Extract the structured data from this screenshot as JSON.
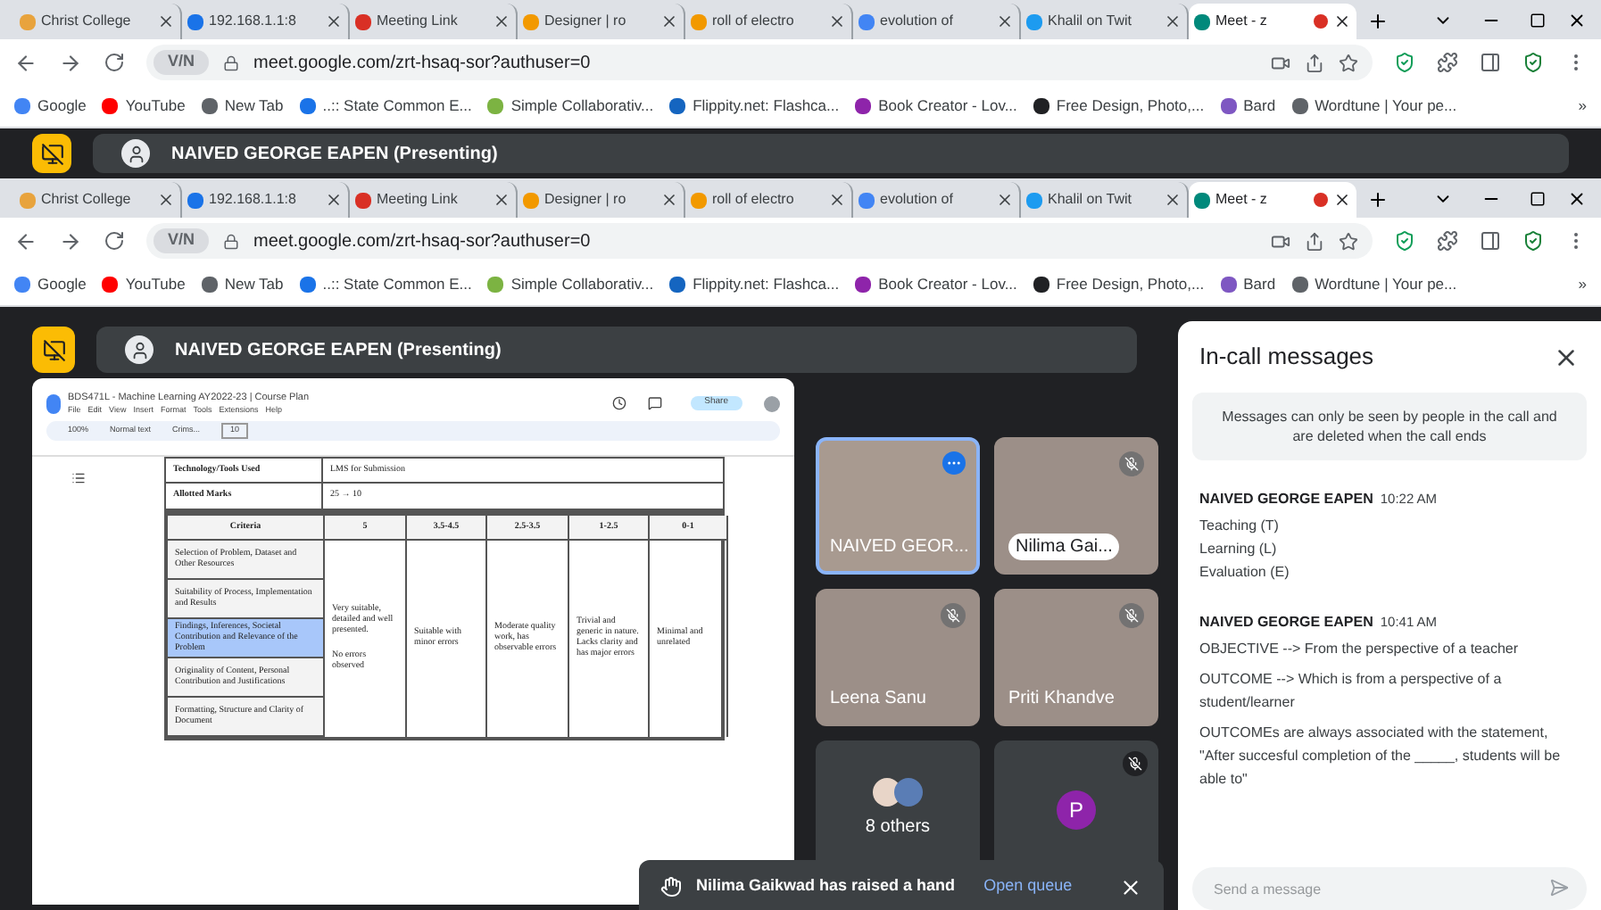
{
  "browsers": [
    {
      "tabs": [
        {
          "title": "Christ College",
          "color": "#e8a33d",
          "selected": false,
          "recording": false
        },
        {
          "title": "192.168.1.1:8",
          "color": "#1a73e8",
          "selected": false,
          "recording": false
        },
        {
          "title": "Meeting Link",
          "color": "#d93025",
          "selected": false,
          "recording": false
        },
        {
          "title": "Designer | ro",
          "color": "#f29900",
          "selected": false,
          "recording": false
        },
        {
          "title": "roll of electro",
          "color": "#f29900",
          "selected": false,
          "recording": false
        },
        {
          "title": "evolution of",
          "color": "#4285f4",
          "selected": false,
          "recording": false
        },
        {
          "title": "Khalil on Twit",
          "color": "#1d9bf0",
          "selected": false,
          "recording": false
        },
        {
          "title": "Meet - z",
          "color": "#00897b",
          "selected": true,
          "recording": true
        }
      ],
      "vpn_badge": "V/N",
      "address": "meet.google.com/zrt-hsaq-sor?authuser=0",
      "bookmarks": [
        {
          "label": "Google",
          "color": "#4285f4"
        },
        {
          "label": "YouTube",
          "color": "#ff0000"
        },
        {
          "label": "New Tab",
          "color": "#5f6368"
        },
        {
          "label": "..:: State Common E...",
          "color": "#1a73e8"
        },
        {
          "label": "Simple Collaborativ...",
          "color": "#7cb342"
        },
        {
          "label": "Flippity.net: Flashca...",
          "color": "#1565c0"
        },
        {
          "label": "Book Creator - Lov...",
          "color": "#8e24aa"
        },
        {
          "label": "Free Design, Photo,...",
          "color": "#202124"
        },
        {
          "label": "Bard",
          "color": "#7e57c2"
        },
        {
          "label": "Wordtune | Your pe...",
          "color": "#5f6368"
        }
      ],
      "overflow": "»",
      "presenter_banner": "NAIVED GEORGE EAPEN (Presenting)"
    },
    {
      "tabs": [
        {
          "title": "Christ College",
          "color": "#e8a33d",
          "selected": false,
          "recording": false
        },
        {
          "title": "192.168.1.1:8",
          "color": "#1a73e8",
          "selected": false,
          "recording": false
        },
        {
          "title": "Meeting Link",
          "color": "#d93025",
          "selected": false,
          "recording": false
        },
        {
          "title": "Designer | ro",
          "color": "#f29900",
          "selected": false,
          "recording": false
        },
        {
          "title": "roll of electro",
          "color": "#f29900",
          "selected": false,
          "recording": false
        },
        {
          "title": "evolution of",
          "color": "#4285f4",
          "selected": false,
          "recording": false
        },
        {
          "title": "Khalil on Twit",
          "color": "#1d9bf0",
          "selected": false,
          "recording": false
        },
        {
          "title": "Meet - z",
          "color": "#00897b",
          "selected": true,
          "recording": true
        }
      ],
      "vpn_badge": "V/N",
      "address": "meet.google.com/zrt-hsaq-sor?authuser=0",
      "bookmarks": [
        {
          "label": "Google",
          "color": "#4285f4"
        },
        {
          "label": "YouTube",
          "color": "#ff0000"
        },
        {
          "label": "New Tab",
          "color": "#5f6368"
        },
        {
          "label": "..:: State Common E...",
          "color": "#1a73e8"
        },
        {
          "label": "Simple Collaborativ...",
          "color": "#7cb342"
        },
        {
          "label": "Flippity.net: Flashca...",
          "color": "#1565c0"
        },
        {
          "label": "Book Creator - Lov...",
          "color": "#8e24aa"
        },
        {
          "label": "Free Design, Photo,...",
          "color": "#202124"
        },
        {
          "label": "Bard",
          "color": "#7e57c2"
        },
        {
          "label": "Wordtune | Your pe...",
          "color": "#5f6368"
        }
      ],
      "overflow": "»",
      "presenter_banner": "NAIVED GEORGE EAPEN (Presenting)"
    }
  ],
  "doc": {
    "title": "BDS471L - Machine Learning AY2022-23 | Course Plan",
    "menus": [
      "File",
      "Edit",
      "View",
      "Insert",
      "Format",
      "Tools",
      "Extensions",
      "Help"
    ],
    "share": "Share",
    "zoom": "100%",
    "style": "Normal text",
    "font": "Crims...",
    "size": "10",
    "info_rows": [
      {
        "label": "Technology/Tools Used",
        "value": "LMS for Submission"
      },
      {
        "label": "Allotted Marks",
        "value": "25 → 10"
      }
    ],
    "columns": [
      "Criteria",
      "5",
      "3.5-4.5",
      "2.5-3.5",
      "1-2.5",
      "0-1"
    ],
    "criteria": [
      {
        "text": "Selection of Problem, Dataset and Other Resources",
        "selected": false
      },
      {
        "text": "Suitability of Process, Implementation and Results",
        "selected": false
      },
      {
        "text": "Findings, Inferences, Societal Contribution and Relevance of the Problem",
        "selected": true
      },
      {
        "text": "Originality of Content, Personal Contribution and Justifications",
        "selected": false
      },
      {
        "text": "Formatting, Structure and Clarity of Document",
        "selected": false
      }
    ],
    "descriptions": [
      [
        "Very suitable, detailed and well presented.",
        "No errors observed"
      ],
      [
        "Suitable with minor errors"
      ],
      [
        "Moderate quality work, has observable errors"
      ],
      [
        "Trivial and generic in nature. Lacks clarity and has major errors"
      ],
      [
        "Minimal and unrelated"
      ]
    ]
  },
  "tiles": [
    {
      "kind": "video",
      "name": "NAIVED GEOR...",
      "muted": false,
      "speaking": true
    },
    {
      "kind": "video",
      "name": "Nilima Gai...",
      "muted": true,
      "speaking": false
    },
    {
      "kind": "video",
      "name": "Leena Sanu",
      "muted": true,
      "speaking": false
    },
    {
      "kind": "video",
      "name": "Priti Khandve",
      "muted": true,
      "speaking": false
    },
    {
      "kind": "others",
      "name": "8 others"
    },
    {
      "kind": "avatar",
      "letter": "P",
      "color": "#8e24aa",
      "muted": true
    }
  ],
  "notification": {
    "text": "Nilima Gaikwad has raised a hand",
    "action": "Open queue"
  },
  "chat": {
    "title": "In-call messages",
    "notice": "Messages can only be seen by people in the call and are deleted when the call ends",
    "messages": [
      {
        "sender": "NAIVED GEORGE EAPEN",
        "time": "10:22 AM",
        "paragraphs": [
          [
            "Teaching (T)",
            "Learning (L)",
            "Evaluation (E)"
          ]
        ]
      },
      {
        "sender": "NAIVED GEORGE EAPEN",
        "time": "10:41 AM",
        "paragraphs": [
          [
            "OBJECTIVE --> From the perspective of a teacher"
          ],
          [
            "OUTCOME --> Which is from a perspective of a student/learner"
          ],
          [
            "OUTCOMEs are always associated with the statement,",
            "\"After succesful completion of the _____, students will be able to\""
          ]
        ]
      }
    ],
    "placeholder": "Send a message"
  }
}
